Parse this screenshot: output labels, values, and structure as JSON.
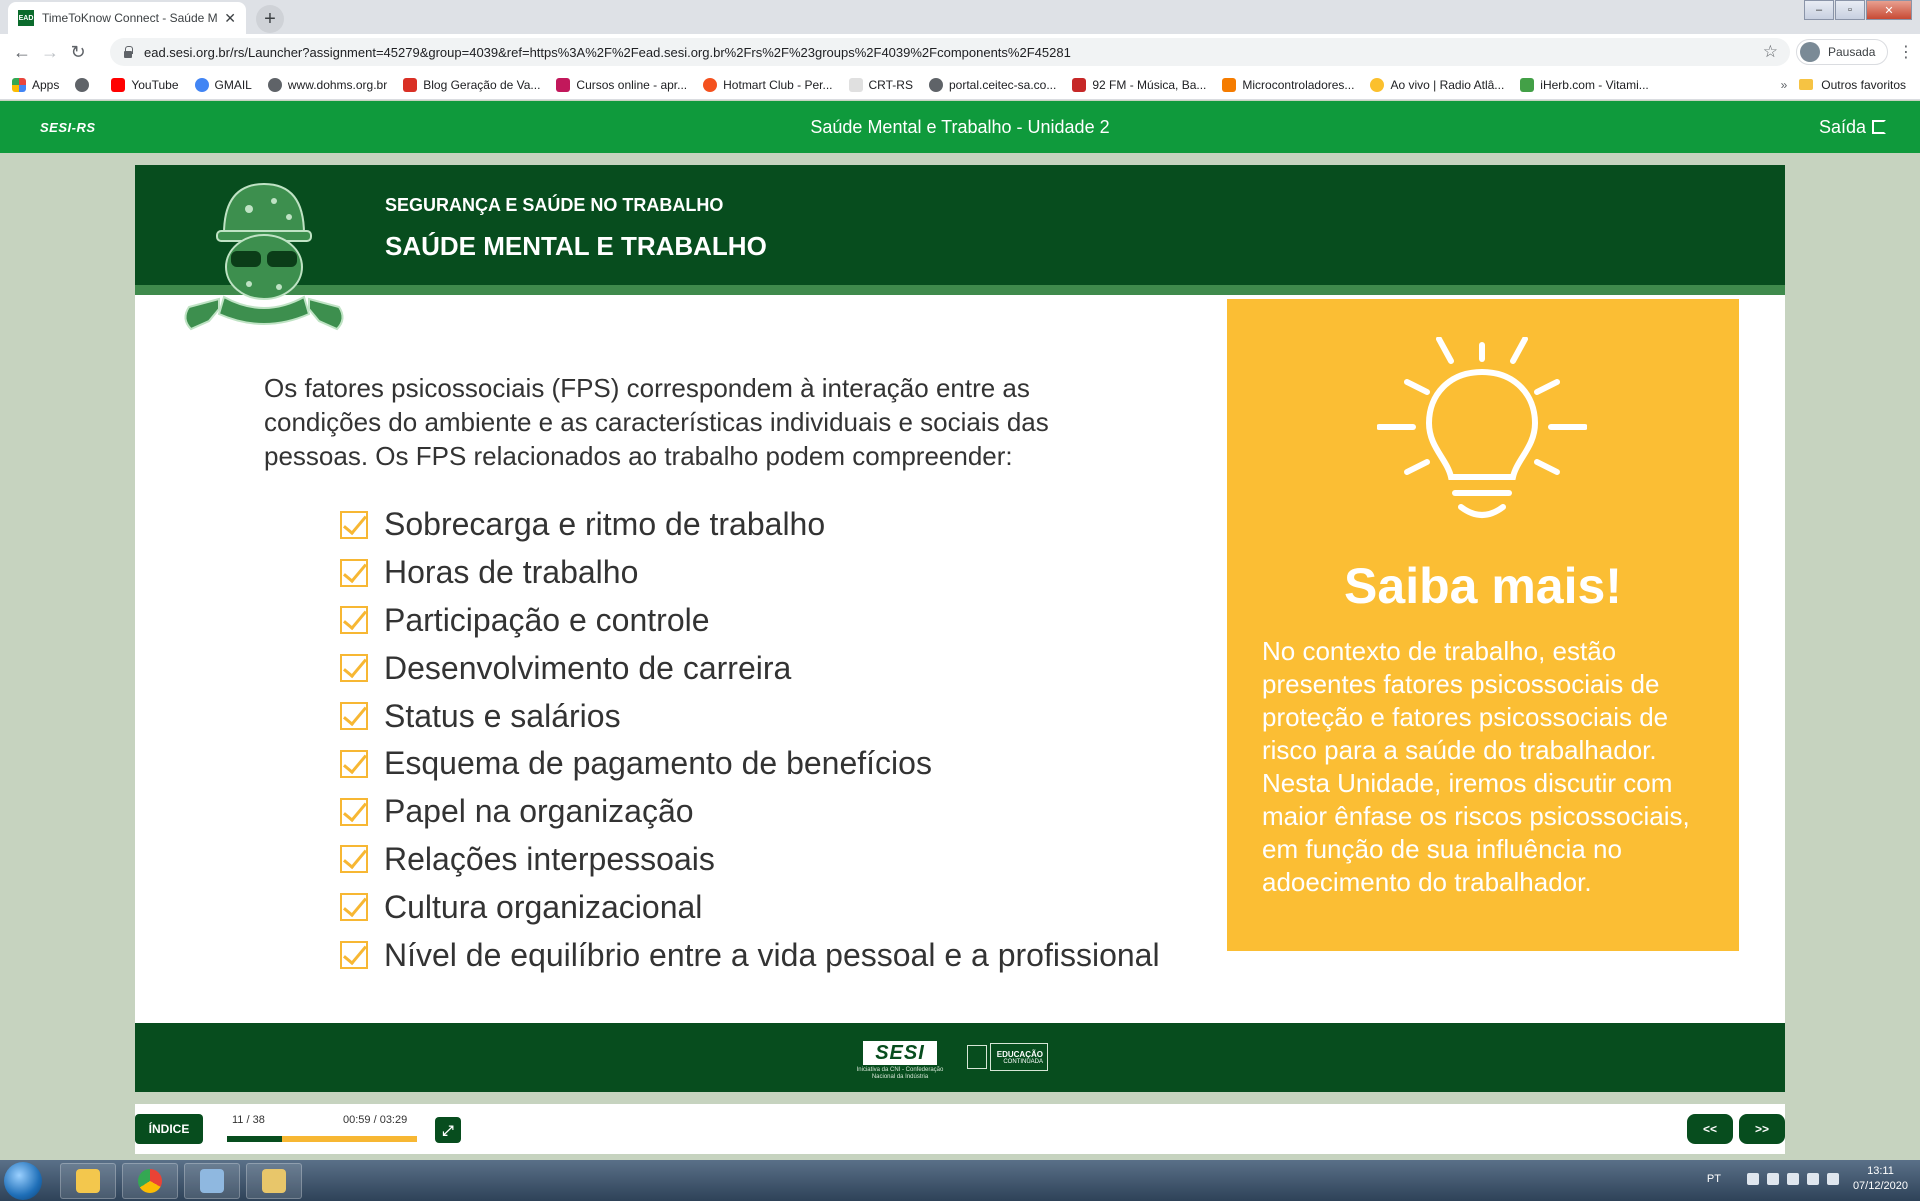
{
  "browser": {
    "tab_favicon": "EAD",
    "tab_title": "TimeToKnow Connect - Saúde M",
    "url": "ead.sesi.org.br/rs/Launcher?assignment=45279&group=4039&ref=https%3A%2F%2Fead.sesi.org.br%2Frs%2F%23groups%2F4039%2Fcomponents%2F45281",
    "profile_label": "Pausada",
    "bookmarks": [
      {
        "label": "Apps",
        "color": "#e8453c"
      },
      {
        "label": "",
        "color": "#5f6368"
      },
      {
        "label": "YouTube",
        "color": "#ff0000"
      },
      {
        "label": "GMAIL",
        "color": "#4285f4"
      },
      {
        "label": "www.dohms.org.br",
        "color": "#5f6368"
      },
      {
        "label": "Blog Geração de Va...",
        "color": "#d93025"
      },
      {
        "label": "Cursos online - apr...",
        "color": "#c2185b"
      },
      {
        "label": "Hotmart Club - Per...",
        "color": "#f4511e"
      },
      {
        "label": "CRT-RS",
        "color": "#9e9e9e"
      },
      {
        "label": "portal.ceitec-sa.co...",
        "color": "#5f6368"
      },
      {
        "label": "92 FM - Música, Ba...",
        "color": "#c62828"
      },
      {
        "label": "Microcontroladores...",
        "color": "#f57c00"
      },
      {
        "label": "Ao vivo | Radio Atlâ...",
        "color": "#fbc02d"
      },
      {
        "label": "iHerb.com - Vitami...",
        "color": "#43a047"
      }
    ],
    "bookmarks_overflow": "»",
    "other_bookmarks": "Outros favoritos"
  },
  "app": {
    "logo_text": "SESI-RS",
    "title": "Saúde Mental e Trabalho - Unidade 2",
    "exit_label": "Saída"
  },
  "slide": {
    "kicker": "SEGURANÇA E SAÚDE NO TRABALHO",
    "title": "SAÚDE MENTAL E TRABALHO",
    "intro": "Os fatores psicossociais (FPS) correspondem à interação entre as condições do ambiente e as características individuais e sociais das pessoas. Os FPS relacionados ao trabalho podem compreender:",
    "items": [
      "Sobrecarga e ritmo de trabalho",
      "Horas de trabalho",
      "Participação e controle",
      "Desenvolvimento de carreira",
      "Status e salários",
      "Esquema de pagamento de benefícios",
      "Papel na organização",
      "Relações interpessoais",
      "Cultura organizacional",
      "Nível de equilíbrio entre a vida pessoal e a profissional"
    ],
    "card_heading": "Saiba mais!",
    "card_text": "No contexto de trabalho, estão presentes fatores psicossociais de proteção e fatores psicossociais de risco para a saúde do trabalhador. Nesta Unidade, iremos discutir com maior ênfase os riscos psicossociais, em função de sua influência no adoecimento do trabalhador.",
    "footer_logo": "SESI",
    "footer_logo_sub": "Iniciativa da CNI - Confederação Nacional da Indústria",
    "footer_edu_line1": "EDUCAÇÃO",
    "footer_edu_line2": "CONTINUADA"
  },
  "player": {
    "index_label": "ÍNDICE",
    "slide_counter": "11 / 38",
    "time_counter": "00:59 / 03:29",
    "progress": 0.29,
    "prev_label": "<<",
    "next_label": ">>"
  },
  "taskbar": {
    "lang": "PT",
    "time": "13:11",
    "date": "07/12/2020"
  },
  "colors": {
    "brand_green": "#0f9a3c",
    "dark_green": "#074d1e",
    "accent_yellow": "#fbbe34"
  }
}
